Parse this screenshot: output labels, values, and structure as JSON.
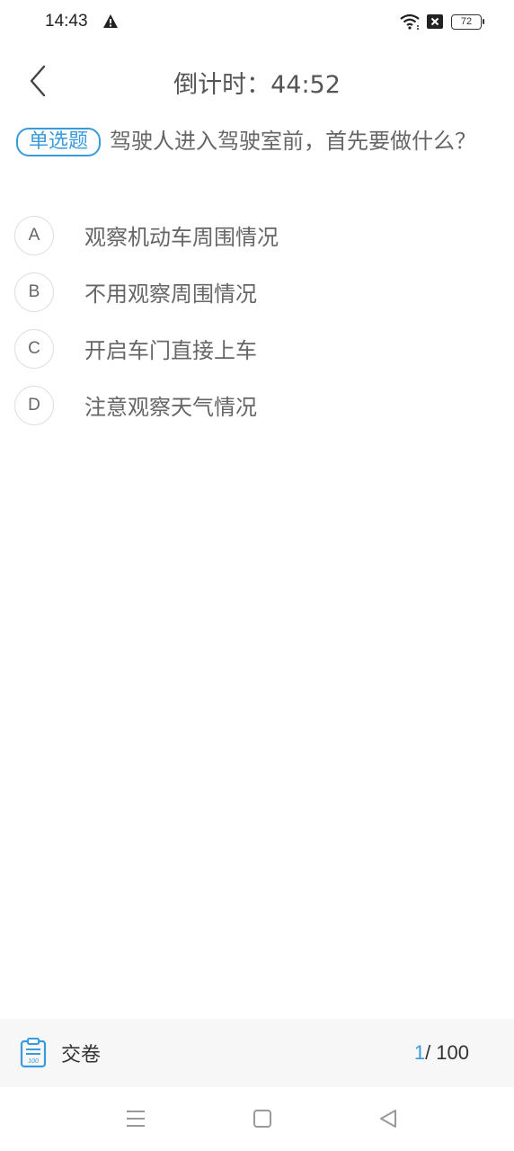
{
  "status_bar": {
    "time": "14:43",
    "battery": "72",
    "icons": [
      "warning-icon",
      "wifi-icon",
      "no-sim-icon",
      "battery-icon"
    ]
  },
  "header": {
    "countdown": "倒计时：44:52"
  },
  "question": {
    "type_label": "单选题",
    "text": "驾驶人进入驾驶室前，首先要做什么？"
  },
  "options": [
    {
      "letter": "A",
      "text": "观察机动车周围情况"
    },
    {
      "letter": "B",
      "text": "不用观察周围情况"
    },
    {
      "letter": "C",
      "text": "开启车门直接上车"
    },
    {
      "letter": "D",
      "text": "注意观察天气情况"
    }
  ],
  "bottom_bar": {
    "submit_label": "交卷",
    "progress_current": "1",
    "progress_total": "/ 100"
  },
  "colors": {
    "accent": "#3a9bdc",
    "text": "#666666",
    "bottom_bar_bg": "#f7f7f7"
  }
}
